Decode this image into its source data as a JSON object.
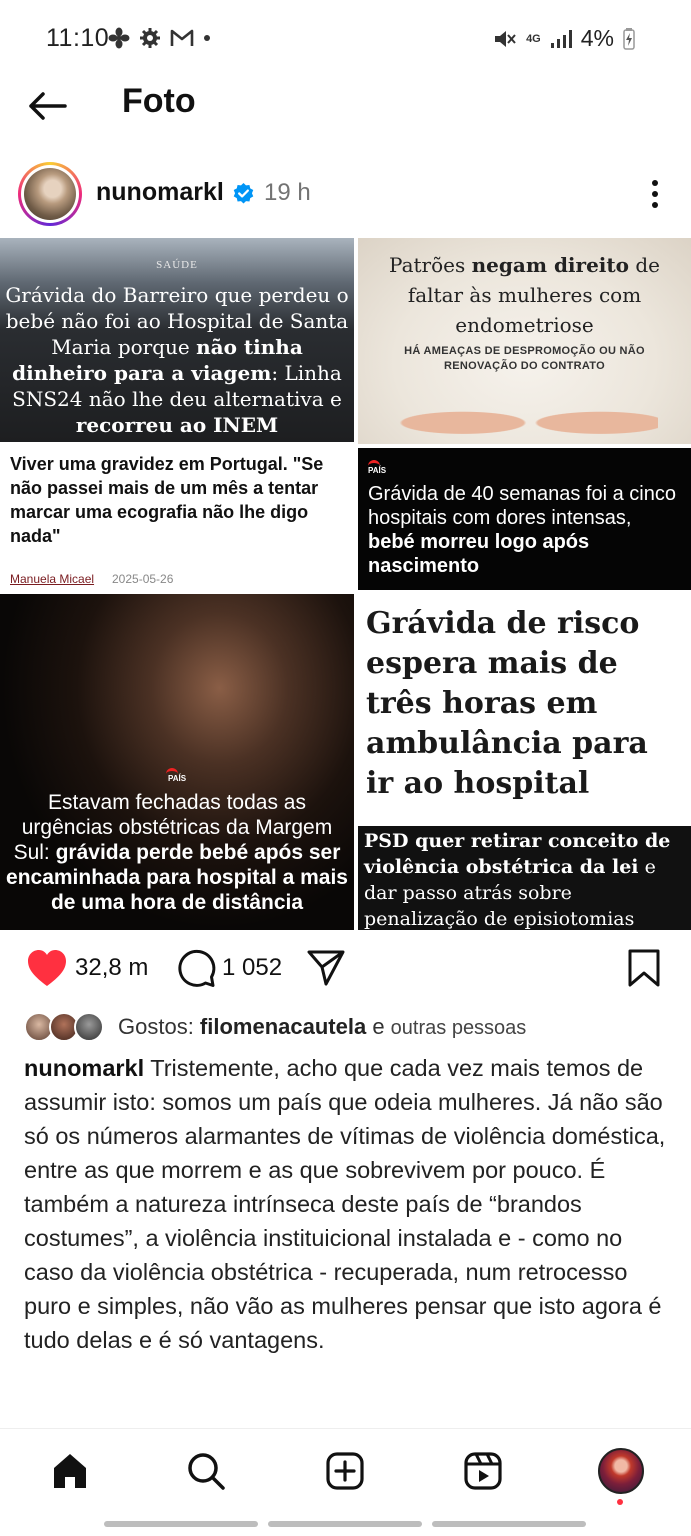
{
  "status_bar": {
    "time": "11:10",
    "battery": "4%",
    "network": "4G",
    "icons": [
      "fan-icon",
      "gear-icon",
      "gmail-icon",
      "dot-icon",
      "mute-icon",
      "signal-icon",
      "battery-charging-icon"
    ]
  },
  "header": {
    "title": "Foto",
    "back_icon": "arrow-left-icon"
  },
  "post": {
    "username": "nunomarkl",
    "verified_icon": "verified-badge-icon",
    "time": "19 h",
    "more_icon": "more-vertical-icon"
  },
  "collage": {
    "tile1": {
      "kicker": "SAÚDE",
      "text_a": "Grávida do Barreiro que perdeu o bebé não foi ao Hospital de Santa Maria porque ",
      "bold_a": "não tinha dinheiro para a viagem",
      "text_b": ": Linha SNS24 não lhe deu alternativa e ",
      "bold_b": "recorreu ao INEM"
    },
    "tile2": {
      "text_a": "Patrões ",
      "bold_a": "negam direito",
      "text_b": " de faltar às mulheres com endometriose",
      "sub": "HÁ AMEAÇAS DE DESPROMOÇÃO OU NÃO RENOVAÇÃO DO CONTRATO"
    },
    "tile3": {
      "headline": "Viver uma gravidez em Portugal. \"Se não passei mais de um mês a tentar marcar uma ecografia não lhe digo nada\"",
      "author": "Manuela Micael",
      "date": "2025-05-26"
    },
    "tile4": {
      "tag": "PAÍS",
      "text_a": "Grávida de 40 semanas foi a cinco hospitais com dores intensas, ",
      "bold_a": "bebé morreu logo após nascimento"
    },
    "tile5": {
      "tag": "PAÍS",
      "text_a": "Estavam fechadas todas as urgências obstétricas da Margem Sul: ",
      "bold_a": "grávida perde bebé após ser encaminhada para hospital a mais de uma hora de distância"
    },
    "tile6": {
      "headline": "Grávida de risco espera mais de três horas em ambulância para ir ao hospital"
    },
    "tile7": {
      "bold_a": "PSD quer retirar conceito de violência obstétrica da lei",
      "text_a": " e dar passo atrás sobre penalização de episiotomias"
    }
  },
  "actions": {
    "likes": "32,8 m",
    "comments": "1 052",
    "like_icon": "heart-filled-icon",
    "comment_icon": "comment-icon",
    "share_icon": "send-icon",
    "save_icon": "bookmark-icon",
    "like_color": "#ff3040"
  },
  "likes_line": {
    "prefix": "Gostos: ",
    "name": "filomenacautela",
    "suffix": " e ",
    "others": "outras pessoas"
  },
  "caption": {
    "username": "nunomarkl",
    "text": " Tristemente, acho que cada vez mais temos de assumir isto: somos um país que odeia mulheres. Já não são só os números alarmantes de vítimas de violência doméstica, entre as que morrem e as que sobrevivem por pouco. É também a natureza intrínseca deste país de “brandos costumes”, a violência instituicional instalada e - como no caso da violência obstétrica - recuperada, num retrocesso puro e simples, não vão as mulheres pensar que isto agora é tudo delas e é só vantagens."
  },
  "bottom_nav": {
    "items": [
      "home-icon",
      "search-icon",
      "create-icon",
      "reels-icon",
      "profile-avatar"
    ]
  }
}
